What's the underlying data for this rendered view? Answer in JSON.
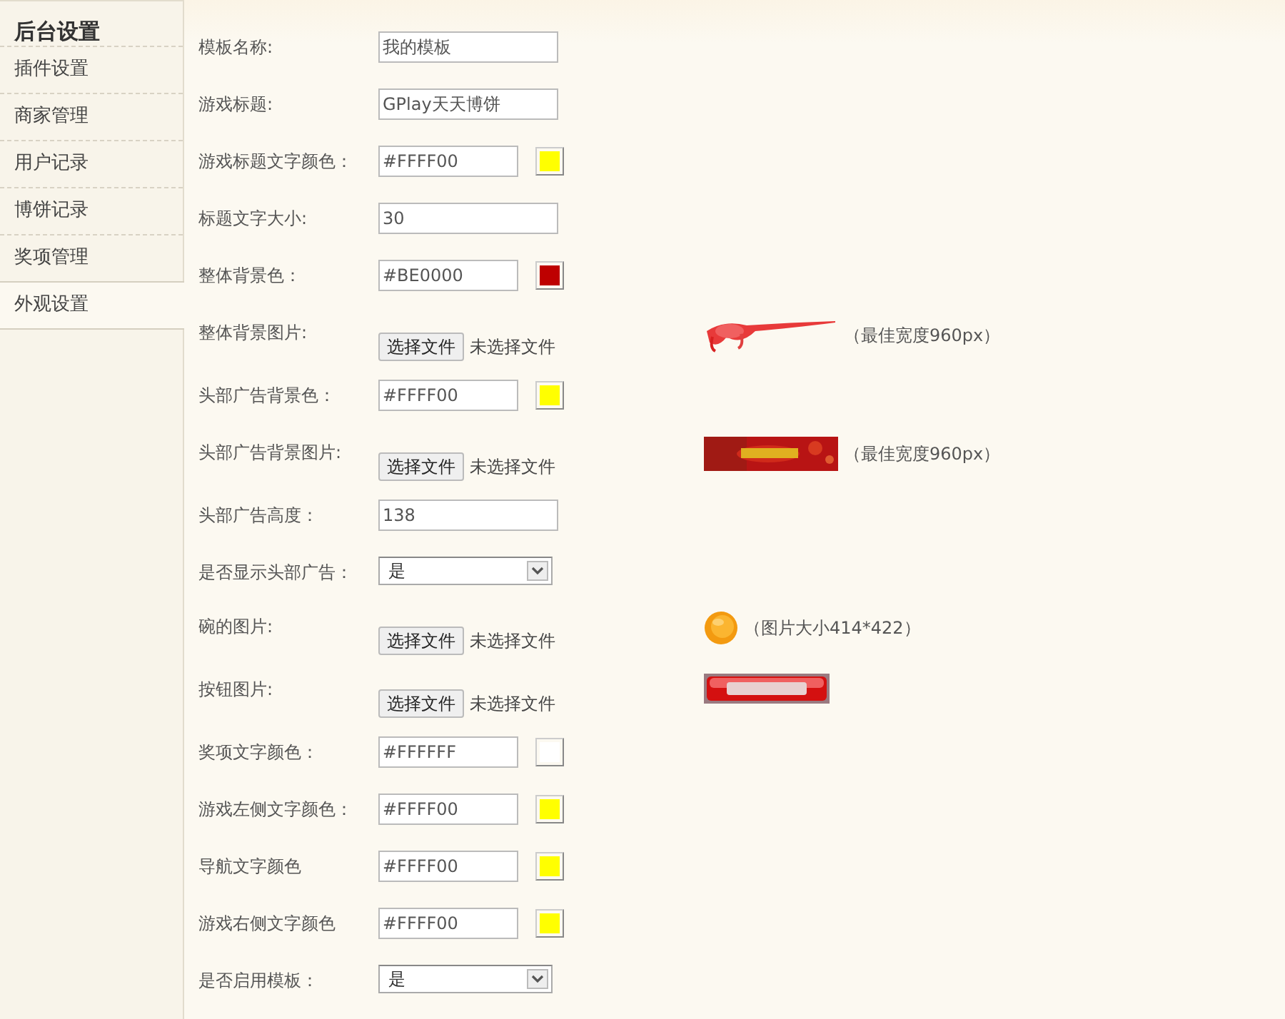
{
  "sidebar": {
    "title": "后台设置",
    "items": [
      {
        "label": "插件设置",
        "selected": false
      },
      {
        "label": "商家管理",
        "selected": false
      },
      {
        "label": "用户记录",
        "selected": false
      },
      {
        "label": "博饼记录",
        "selected": false
      },
      {
        "label": "奖项管理",
        "selected": false
      },
      {
        "label": "外观设置",
        "selected": true
      }
    ]
  },
  "form": {
    "rows": [
      {
        "kind": "text",
        "label": "模板名称:",
        "value": "我的模板"
      },
      {
        "kind": "text",
        "label": "游戏标题:",
        "value": "GPlay天天博饼"
      },
      {
        "kind": "color",
        "label": "游戏标题文字颜色：",
        "value": "#FFFF00",
        "color": "#ffff00"
      },
      {
        "kind": "text",
        "label": "标题文字大小:",
        "value": "30"
      },
      {
        "kind": "color",
        "label": "整体背景色：",
        "value": "#BE0000",
        "color": "#be0000"
      },
      {
        "kind": "file",
        "label": "整体背景图片:",
        "button": "选择文件",
        "status": "未选择文件",
        "note": "（最佳宽度960px）"
      },
      {
        "kind": "color",
        "label": "头部广告背景色：",
        "value": "#FFFF00",
        "color": "#ffff00"
      },
      {
        "kind": "file",
        "label": "头部广告背景图片:",
        "button": "选择文件",
        "status": "未选择文件",
        "note": "（最佳宽度960px）"
      },
      {
        "kind": "text",
        "label": "头部广告高度：",
        "value": "138"
      },
      {
        "kind": "select",
        "label": "是否显示头部广告：",
        "value": "是"
      },
      {
        "kind": "file",
        "label": "碗的图片:",
        "button": "选择文件",
        "status": "未选择文件",
        "note": "（图片大小414*422）"
      },
      {
        "kind": "file",
        "label": "按钮图片:",
        "button": "选择文件",
        "status": "未选择文件"
      },
      {
        "kind": "color",
        "label": "奖项文字颜色：",
        "value": "#FFFFFF",
        "color": "#ffffff"
      },
      {
        "kind": "color",
        "label": "游戏左侧文字颜色：",
        "value": "#FFFF00",
        "color": "#ffff00"
      },
      {
        "kind": "color",
        "label": "导航文字颜色",
        "value": "#FFFF00",
        "color": "#ffff00"
      },
      {
        "kind": "color",
        "label": "游戏右侧文字颜色",
        "value": "#FFFF00",
        "color": "#ffff00"
      },
      {
        "kind": "select",
        "label": "是否启用模板：",
        "value": "是"
      }
    ]
  }
}
